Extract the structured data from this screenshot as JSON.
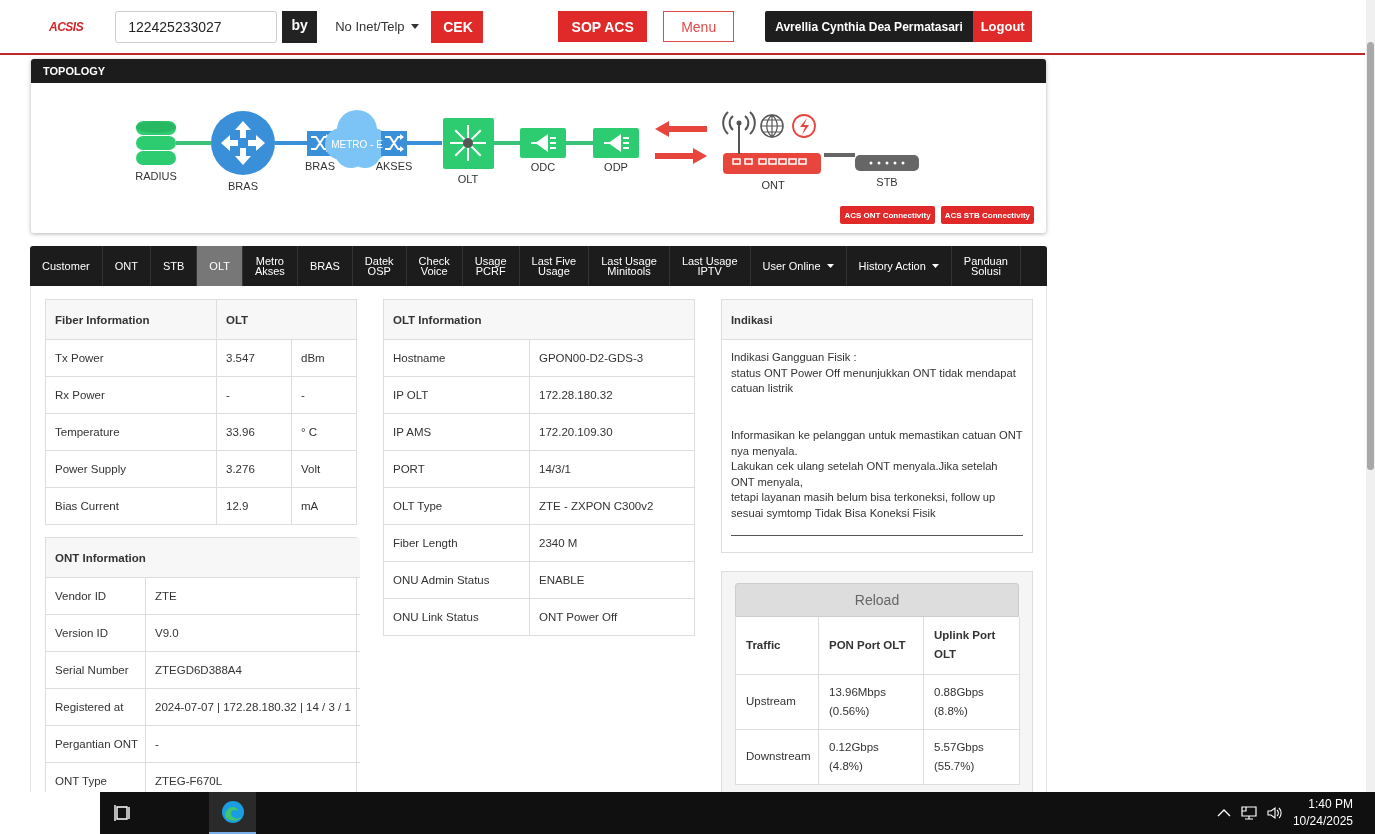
{
  "header": {
    "logo": "ACSIS",
    "search": {
      "value": "122425233027"
    },
    "by_label": "by",
    "search_type": "No Inet/Telp",
    "check_button": "CEK",
    "sop_button": "SOP ACS",
    "menu_button": "Menu",
    "user_name": "Avrellia Cynthia Dea Permatasari",
    "logout_button": "Logout"
  },
  "topology": {
    "title": "TOPOLOGY",
    "nodes": [
      {
        "kind": "database",
        "label": "RADIUS"
      },
      {
        "kind": "router",
        "label": "BRAS"
      },
      {
        "kind": "switch",
        "label": "BRAS"
      },
      {
        "kind": "cloud",
        "label": "METRO - E"
      },
      {
        "kind": "switch",
        "label": "AKSES"
      },
      {
        "kind": "olt",
        "label": "OLT"
      },
      {
        "kind": "splitter",
        "label": "ODC"
      },
      {
        "kind": "splitter",
        "label": "ODP"
      },
      {
        "kind": "ont",
        "label": "ONT"
      },
      {
        "kind": "stb",
        "label": "STB"
      }
    ],
    "buttons": [
      "ACS ONT Connectivity",
      "ACS STB Connectivity"
    ]
  },
  "tabs": [
    {
      "label": "Customer",
      "selected": false,
      "dropdown": false
    },
    {
      "label": "ONT",
      "selected": false,
      "dropdown": false
    },
    {
      "label": "STB",
      "selected": false,
      "dropdown": false
    },
    {
      "label": "OLT",
      "selected": true,
      "dropdown": false
    },
    {
      "label": "Metro\nAkses",
      "selected": false,
      "dropdown": false
    },
    {
      "label": "BRAS",
      "selected": false,
      "dropdown": false
    },
    {
      "label": "Datek\nOSP",
      "selected": false,
      "dropdown": false
    },
    {
      "label": "Check\nVoice",
      "selected": false,
      "dropdown": false
    },
    {
      "label": "Usage\nPCRF",
      "selected": false,
      "dropdown": false
    },
    {
      "label": "Last Five\nUsage",
      "selected": false,
      "dropdown": false
    },
    {
      "label": "Last Usage\nMinitools",
      "selected": false,
      "dropdown": false
    },
    {
      "label": "Last Usage\nIPTV",
      "selected": false,
      "dropdown": false
    },
    {
      "label": "User Online",
      "selected": false,
      "dropdown": true
    },
    {
      "label": "History Action",
      "selected": false,
      "dropdown": true
    },
    {
      "label": "Panduan\nSolusi",
      "selected": false,
      "dropdown": false
    }
  ],
  "fiber_information": {
    "header": [
      "Fiber Information",
      "OLT"
    ],
    "rows": [
      [
        "Tx Power",
        "3.547",
        "dBm"
      ],
      [
        "Rx Power",
        "-",
        "-"
      ],
      [
        "Temperature",
        "33.96",
        "° C"
      ],
      [
        "Power Supply",
        "3.276",
        "Volt"
      ],
      [
        "Bias Current",
        "12.9",
        "mA"
      ]
    ]
  },
  "ont_information": {
    "header": [
      "ONT Information"
    ],
    "rows": [
      [
        "Vendor ID",
        "ZTE"
      ],
      [
        "Version ID",
        "V9.0"
      ],
      [
        "Serial Number",
        "ZTEGD6D388A4"
      ],
      [
        "Registered at",
        "2024-07-07 | 172.28.180.32 | 14 / 3 / 1"
      ],
      [
        "Pergantian ONT",
        "-"
      ],
      [
        "ONT Type",
        "ZTEG-F670L"
      ]
    ]
  },
  "olt_information": {
    "header": [
      "OLT Information"
    ],
    "rows": [
      [
        "Hostname",
        "GPON00-D2-GDS-3"
      ],
      [
        "IP OLT",
        "172.28.180.32"
      ],
      [
        "IP AMS",
        "172.20.109.30"
      ],
      [
        "PORT",
        "14/3/1"
      ],
      [
        "OLT Type",
        "ZTE - ZXPON C300v2"
      ],
      [
        "Fiber Length",
        "2340 M"
      ],
      [
        "ONU Admin Status",
        "ENABLE"
      ],
      [
        "ONU Link Status",
        "ONT Power Off"
      ]
    ]
  },
  "indikasi": {
    "title": "Indikasi",
    "text": "Indikasi Gangguan Fisik :\nstatus ONT Power Off menunjukkan ONT tidak mendapat catuan listrik\n\n\nInformasikan ke pelanggan untuk memastikan catuan ONT nya menyala.\nLakukan cek ulang setelah ONT menyala.Jika setelah ONT menyala,\ntetapi layanan masih belum bisa terkoneksi, follow up sesuai symtomp Tidak Bisa Koneksi Fisik"
  },
  "traffic": {
    "reload_button": "Reload",
    "header": [
      "Traffic",
      "PON Port OLT",
      "Uplink Port OLT"
    ],
    "rows": [
      [
        "Upstream",
        "13.96Mbps (0.56%)",
        "0.88Gbps (8.8%)"
      ],
      [
        "Downstream",
        "0.12Gbps (4.8%)",
        "5.57Gbps (55.7%)"
      ]
    ]
  },
  "taskbar": {
    "time": "1:40 PM",
    "date": "10/24/2025"
  }
}
